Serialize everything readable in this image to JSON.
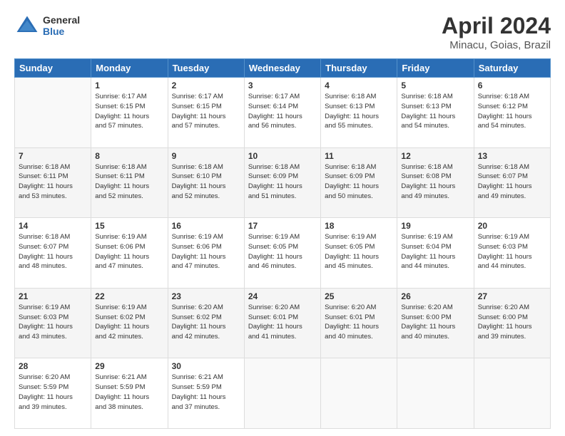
{
  "header": {
    "logo_general": "General",
    "logo_blue": "Blue",
    "title": "April 2024",
    "location": "Minacu, Goias, Brazil"
  },
  "weekdays": [
    "Sunday",
    "Monday",
    "Tuesday",
    "Wednesday",
    "Thursday",
    "Friday",
    "Saturday"
  ],
  "weeks": [
    [
      {
        "day": "",
        "info": ""
      },
      {
        "day": "1",
        "info": "Sunrise: 6:17 AM\nSunset: 6:15 PM\nDaylight: 11 hours\nand 57 minutes."
      },
      {
        "day": "2",
        "info": "Sunrise: 6:17 AM\nSunset: 6:15 PM\nDaylight: 11 hours\nand 57 minutes."
      },
      {
        "day": "3",
        "info": "Sunrise: 6:17 AM\nSunset: 6:14 PM\nDaylight: 11 hours\nand 56 minutes."
      },
      {
        "day": "4",
        "info": "Sunrise: 6:18 AM\nSunset: 6:13 PM\nDaylight: 11 hours\nand 55 minutes."
      },
      {
        "day": "5",
        "info": "Sunrise: 6:18 AM\nSunset: 6:13 PM\nDaylight: 11 hours\nand 54 minutes."
      },
      {
        "day": "6",
        "info": "Sunrise: 6:18 AM\nSunset: 6:12 PM\nDaylight: 11 hours\nand 54 minutes."
      }
    ],
    [
      {
        "day": "7",
        "info": "Sunrise: 6:18 AM\nSunset: 6:11 PM\nDaylight: 11 hours\nand 53 minutes."
      },
      {
        "day": "8",
        "info": "Sunrise: 6:18 AM\nSunset: 6:11 PM\nDaylight: 11 hours\nand 52 minutes."
      },
      {
        "day": "9",
        "info": "Sunrise: 6:18 AM\nSunset: 6:10 PM\nDaylight: 11 hours\nand 52 minutes."
      },
      {
        "day": "10",
        "info": "Sunrise: 6:18 AM\nSunset: 6:09 PM\nDaylight: 11 hours\nand 51 minutes."
      },
      {
        "day": "11",
        "info": "Sunrise: 6:18 AM\nSunset: 6:09 PM\nDaylight: 11 hours\nand 50 minutes."
      },
      {
        "day": "12",
        "info": "Sunrise: 6:18 AM\nSunset: 6:08 PM\nDaylight: 11 hours\nand 49 minutes."
      },
      {
        "day": "13",
        "info": "Sunrise: 6:18 AM\nSunset: 6:07 PM\nDaylight: 11 hours\nand 49 minutes."
      }
    ],
    [
      {
        "day": "14",
        "info": "Sunrise: 6:18 AM\nSunset: 6:07 PM\nDaylight: 11 hours\nand 48 minutes."
      },
      {
        "day": "15",
        "info": "Sunrise: 6:19 AM\nSunset: 6:06 PM\nDaylight: 11 hours\nand 47 minutes."
      },
      {
        "day": "16",
        "info": "Sunrise: 6:19 AM\nSunset: 6:06 PM\nDaylight: 11 hours\nand 47 minutes."
      },
      {
        "day": "17",
        "info": "Sunrise: 6:19 AM\nSunset: 6:05 PM\nDaylight: 11 hours\nand 46 minutes."
      },
      {
        "day": "18",
        "info": "Sunrise: 6:19 AM\nSunset: 6:05 PM\nDaylight: 11 hours\nand 45 minutes."
      },
      {
        "day": "19",
        "info": "Sunrise: 6:19 AM\nSunset: 6:04 PM\nDaylight: 11 hours\nand 44 minutes."
      },
      {
        "day": "20",
        "info": "Sunrise: 6:19 AM\nSunset: 6:03 PM\nDaylight: 11 hours\nand 44 minutes."
      }
    ],
    [
      {
        "day": "21",
        "info": "Sunrise: 6:19 AM\nSunset: 6:03 PM\nDaylight: 11 hours\nand 43 minutes."
      },
      {
        "day": "22",
        "info": "Sunrise: 6:19 AM\nSunset: 6:02 PM\nDaylight: 11 hours\nand 42 minutes."
      },
      {
        "day": "23",
        "info": "Sunrise: 6:20 AM\nSunset: 6:02 PM\nDaylight: 11 hours\nand 42 minutes."
      },
      {
        "day": "24",
        "info": "Sunrise: 6:20 AM\nSunset: 6:01 PM\nDaylight: 11 hours\nand 41 minutes."
      },
      {
        "day": "25",
        "info": "Sunrise: 6:20 AM\nSunset: 6:01 PM\nDaylight: 11 hours\nand 40 minutes."
      },
      {
        "day": "26",
        "info": "Sunrise: 6:20 AM\nSunset: 6:00 PM\nDaylight: 11 hours\nand 40 minutes."
      },
      {
        "day": "27",
        "info": "Sunrise: 6:20 AM\nSunset: 6:00 PM\nDaylight: 11 hours\nand 39 minutes."
      }
    ],
    [
      {
        "day": "28",
        "info": "Sunrise: 6:20 AM\nSunset: 5:59 PM\nDaylight: 11 hours\nand 39 minutes."
      },
      {
        "day": "29",
        "info": "Sunrise: 6:21 AM\nSunset: 5:59 PM\nDaylight: 11 hours\nand 38 minutes."
      },
      {
        "day": "30",
        "info": "Sunrise: 6:21 AM\nSunset: 5:59 PM\nDaylight: 11 hours\nand 37 minutes."
      },
      {
        "day": "",
        "info": ""
      },
      {
        "day": "",
        "info": ""
      },
      {
        "day": "",
        "info": ""
      },
      {
        "day": "",
        "info": ""
      }
    ]
  ]
}
